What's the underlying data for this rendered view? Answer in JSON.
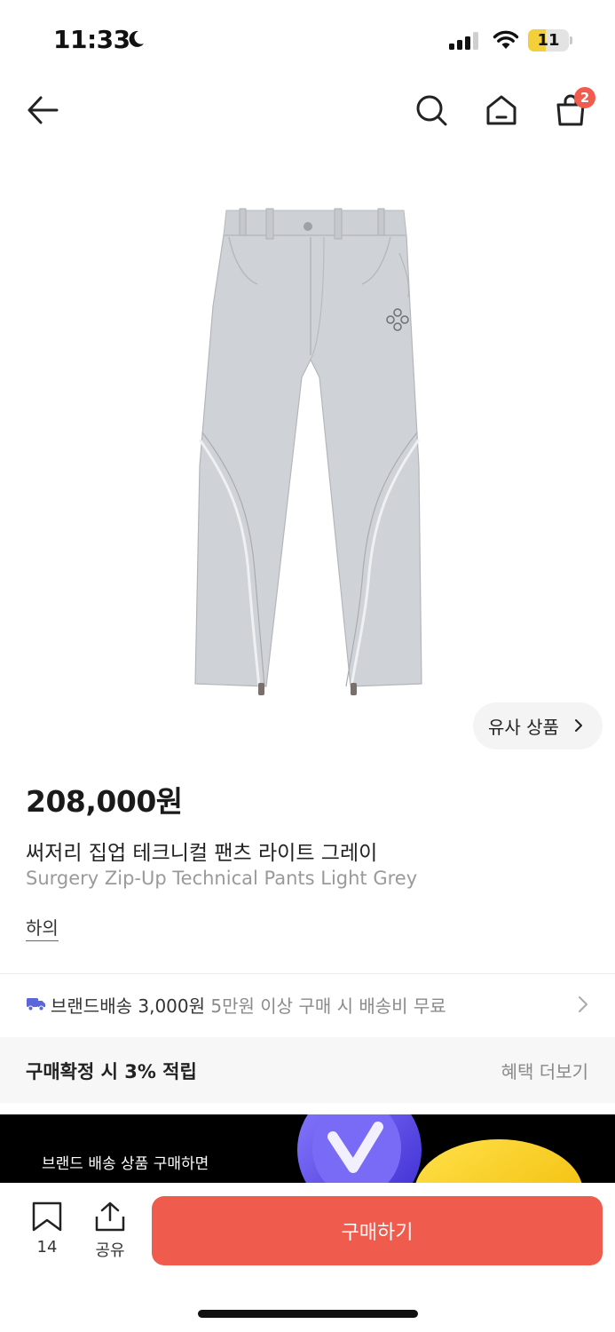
{
  "status_bar": {
    "time": "11:33",
    "battery_level": "11",
    "battery_fraction": 0.11
  },
  "nav": {
    "cart_count": "2"
  },
  "product": {
    "similar_button_label": "유사 상품",
    "price": "208,000원",
    "name_ko": "써저리 집업 테크니컬 팬츠 라이트 그레이",
    "name_en": "Surgery Zip-Up Technical Pants Light Grey",
    "category": "하의"
  },
  "shipping": {
    "label": "브랜드배송 3,000원",
    "note": "5만원 이상 구매 시 배송비 무료"
  },
  "benefit": {
    "label": "구매확정 시 3% 적립",
    "more_label": "혜택 더보기"
  },
  "banner": {
    "text": "브랜드 배송 상품 구매하면"
  },
  "bottom_bar": {
    "bookmark_count": "14",
    "share_label": "공유",
    "buy_label": "구매하기"
  },
  "colors": {
    "accent": "#ef5b4d",
    "badge": "#f25c4e",
    "battery": "#f3cf3a",
    "truck": "#5b67d8"
  }
}
